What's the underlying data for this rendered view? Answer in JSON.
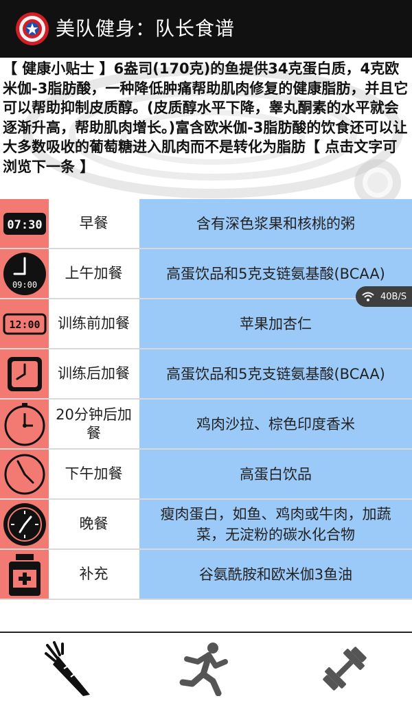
{
  "header": {
    "title": "美队健身：队长食谱"
  },
  "tip": {
    "text": "【 健康小贴士 】6盎司(170克)的鱼提供34克蛋白质，4克欧米伽-3脂肪酸，一种降低肿痛帮助肌肉修复的健康脂肪，并且它可以帮助抑制皮质醇。(皮质醇水平下降，睾丸酮素的水平就会逐渐升高，帮助肌肉增长。)富含欧米伽-3脂肪酸的饮食还可以让大多数吸收的葡萄糖进入肌肉而不是转化为脂肪【 点击文字可浏览下一条 】"
  },
  "meals": [
    {
      "icon": "digital-clock-0730-icon",
      "clock_text": "07:30",
      "name": "早餐",
      "food": "含有深色浆果和核桃的粥"
    },
    {
      "icon": "clock-0900-icon",
      "clock_text": "09:00",
      "name": "上午加餐",
      "food": "高蛋饮品和5克支链氨基酸(BCAA)"
    },
    {
      "icon": "digital-clock-1200-icon",
      "clock_text": "12:00",
      "name": "训练前加餐",
      "food": "苹果加杏仁"
    },
    {
      "icon": "square-clock-icon",
      "name": "训练后加餐",
      "food": "高蛋饮品和5克支链氨基酸(BCAA)"
    },
    {
      "icon": "stopwatch-icon",
      "name": "20分钟后加餐",
      "food": "鸡肉沙拉、棕色印度香米"
    },
    {
      "icon": "clock-outline-icon",
      "name": "下午加餐",
      "food": "高蛋白饮品"
    },
    {
      "icon": "pocket-watch-icon",
      "name": "晚餐",
      "food": "瘦肉蛋白，如鱼、鸡肉或牛肉，加蔬菜，无淀粉的碳水化合物"
    },
    {
      "icon": "supplement-jar-icon",
      "name": "补充",
      "food": "谷氨酰胺和欧米伽3鱼油"
    }
  ],
  "status": {
    "network_speed": "40B/S"
  },
  "bottom_nav": [
    {
      "icon": "carrot-icon",
      "label": "diet"
    },
    {
      "icon": "runner-icon",
      "label": "training"
    },
    {
      "icon": "dumbbell-icon",
      "label": "equipment"
    }
  ],
  "colors": {
    "icon_column": "#f27a72",
    "food_column": "#9ccaf8",
    "titlebar": "#111111"
  }
}
